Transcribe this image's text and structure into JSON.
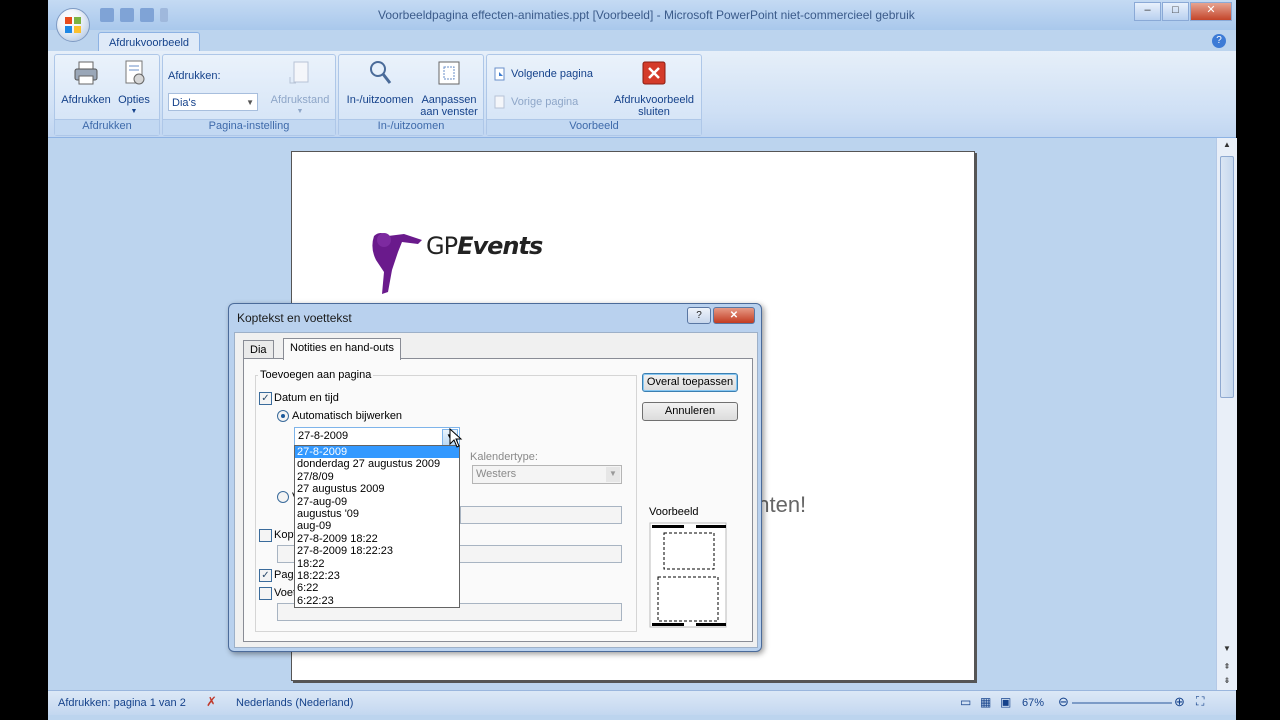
{
  "window": {
    "title": "Voorbeeldpagina effecten-animaties.ppt [Voorbeeld] - Microsoft PowerPoint niet-commercieel gebruik",
    "controls": {
      "minimize": "–",
      "maximize": "□",
      "close": "✕"
    }
  },
  "ribbon": {
    "tab": "Afdrukvoorbeeld",
    "help": "?",
    "groups": {
      "afdrukken": {
        "label": "Afdrukken",
        "print_button": "Afdrukken",
        "options_button": "Opties"
      },
      "pagina_instelling": {
        "label": "Pagina-instelling",
        "print_what_label": "Afdrukken:",
        "print_what_value": "Dia's",
        "orientation_button": "Afdrukstand"
      },
      "zoom": {
        "label": "In-/uitzoomen",
        "zoom_button": "In-/uitzoomen",
        "fit_button_line1": "Aanpassen",
        "fit_button_line2": "aan venster"
      },
      "voorbeeld": {
        "label": "Voorbeeld",
        "next_page": "Volgende pagina",
        "prev_page": "Vorige pagina",
        "close_line1": "Afdrukvoorbeeld",
        "close_line2": "sluiten"
      }
    }
  },
  "slide": {
    "logo_text_regular": "GP",
    "logo_text_bold": "Events",
    "body_text": "enten!"
  },
  "dialog": {
    "title": "Koptekst en voettekst",
    "help": "?",
    "close": "✕",
    "tabs": [
      "Dia",
      "Notities en hand-outs"
    ],
    "active_tab": 1,
    "section_legend": "Toevoegen aan pagina",
    "date_time_label": "Datum en tijd",
    "date_time_checked": true,
    "auto_update_label": "Automatisch bijwerken",
    "fixed_label_partial": "V",
    "date_value": "27-8-2009",
    "date_options": [
      "27-8-2009",
      "donderdag 27 augustus 2009",
      "27/8/09",
      "27 augustus 2009",
      "27-aug-09",
      "augustus '09",
      "aug-09",
      "27-8-2009 18:22",
      "27-8-2009 18:22:23",
      "18:22",
      "18:22:23",
      "6:22",
      "6:22:23"
    ],
    "selected_option_index": 0,
    "calendar_type_label": "Kalendertype:",
    "calendar_type_value": "Westers",
    "header_label_partial": "Kopt",
    "page_number_label_partial": "Pagi",
    "page_number_checked": true,
    "footer_label_partial": "Voet",
    "apply_all_button": "Overal toepassen",
    "cancel_button": "Annuleren",
    "preview_legend": "Voorbeeld"
  },
  "status": {
    "page_info": "Afdrukken: pagina 1 van 2",
    "language": "Nederlands (Nederland)",
    "zoom": "67%"
  },
  "colors": {
    "ribbon_text": "#15428b",
    "selection": "#3399ff",
    "logo_purple": "#6a1a8c"
  }
}
